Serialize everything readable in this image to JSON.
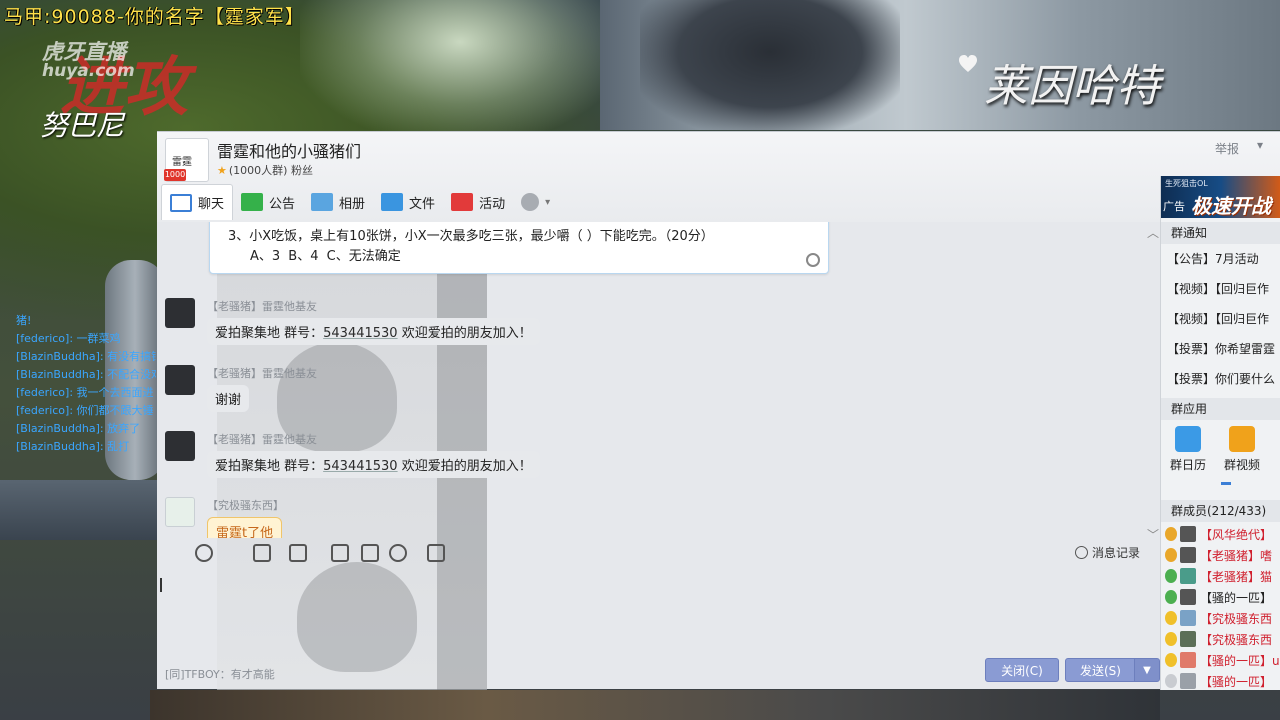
{
  "stream": {
    "top_title": "马甲:90088-你的名字【霆家军】",
    "platform_logo_cn": "虎牙直播",
    "platform_logo_en": "huya.com",
    "role_text": "进攻",
    "hero_left": "努巴尼",
    "hero_right": "莱因哈特",
    "side_chat": [
      "猪!",
      "[federico]: 一群菜鸡",
      "[BlazinBuddha]: 有没有搞错",
      "[BlazinBuddha]: 不配合没戏",
      "[federico]: 我一个去西面进",
      "[federico]: 你们都不跟大锤",
      "[BlazinBuddha]: 放弃了",
      "[BlazinBuddha]: 乱打"
    ]
  },
  "qq": {
    "group_avatar_text": "雷霆",
    "group_badge": "1000",
    "group_name": "雷霆和他的小骚猪们",
    "group_sub": "(1000人群) 粉丝",
    "report": "举报",
    "tabs": [
      {
        "label": "聊天",
        "icon": "chat-icon"
      },
      {
        "label": "公告",
        "icon": "notice-flag-icon"
      },
      {
        "label": "相册",
        "icon": "album-icon"
      },
      {
        "label": "文件",
        "icon": "folder-icon"
      },
      {
        "label": "活动",
        "icon": "activity-flag-icon"
      }
    ],
    "quote_line1": "3、小X吃饭，桌上有10张饼，小X一次最多吃三张，最少嚼（    ）下能吃完。（20分）",
    "quote_line2": "A、3          B、4          C、无法确定",
    "messages": [
      {
        "sender": "【老骚猪】雷霆他基友",
        "text_pre": "爱拍聚集地 群号：",
        "number": "543441530",
        "text_post": " 欢迎爱拍的朋友加入！"
      },
      {
        "sender": "【老骚猪】雷霆他基友",
        "text": "谢谢"
      },
      {
        "sender": "【老骚猪】雷霆他基友",
        "text_pre": "爱拍聚集地 群号：",
        "number": "543441530",
        "text_post": " 欢迎爱拍的朋友加入！"
      },
      {
        "sender": "【究极骚东西】",
        "text": "雷霆t了他"
      }
    ],
    "history_label": "消息记录",
    "input_hint": "[同]TFBOY：有才高能",
    "close_btn": "关闭(C)",
    "send_btn": "发送(S)",
    "right": {
      "ad_small": "生死狙击OL",
      "ad_label": "广告",
      "ad_big": "极速开战",
      "notice_head": "群通知",
      "notices": [
        "【公告】7月活动",
        "【视频】【回归巨作",
        "【视频】【回归巨作",
        "【投票】你希望雷霆",
        "【投票】你们要什么"
      ],
      "apps_head": "群应用",
      "apps": [
        {
          "label": "群日历",
          "icon": "calendar-icon"
        },
        {
          "label": "群视频",
          "icon": "video-icon"
        }
      ],
      "members_head": "群成员(212/433)",
      "members": [
        {
          "name": "【风华绝代】",
          "color": "#d0202e"
        },
        {
          "name": "【老骚猪】嗜",
          "color": "#d0202e"
        },
        {
          "name": "【老骚猪】猫",
          "color": "#d0202e"
        },
        {
          "name": "【骚的一匹】",
          "color": "#222222"
        },
        {
          "name": "【究极骚东西",
          "color": "#d0202e"
        },
        {
          "name": "【究极骚东西",
          "color": "#d0202e"
        },
        {
          "name": "【骚的一匹】u",
          "color": "#d0202e"
        },
        {
          "name": "【骚的一匹】",
          "color": "#d0202e"
        }
      ]
    }
  }
}
